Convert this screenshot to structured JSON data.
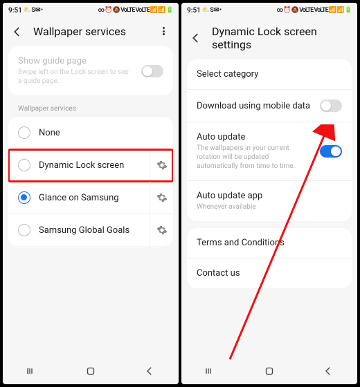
{
  "status": {
    "time": "9:51",
    "left_icons": "⛅ S ✉ •",
    "right_icons": "∞ ⏰ 🔕 VoLTE VoLTE 📶 📶 🔋"
  },
  "left": {
    "title": "Wallpaper services",
    "guide": {
      "title": "Show guide page",
      "sub": "Swipe left on the Lock screen to see a guide page."
    },
    "section_label": "Wallpaper services",
    "items": [
      {
        "label": "None",
        "selected": false,
        "gear": false
      },
      {
        "label": "Dynamic Lock screen",
        "selected": false,
        "gear": true,
        "highlighted": true
      },
      {
        "label": "Glance on Samsung",
        "selected": true,
        "gear": true
      },
      {
        "label": "Samsung Global Goals",
        "selected": false,
        "gear": true
      }
    ]
  },
  "right": {
    "title": "Dynamic Lock screen settings",
    "rows": {
      "select_category": "Select category",
      "download_mobile": "Download using mobile data",
      "auto_update": {
        "title": "Auto update",
        "sub": "The wallpapers in your current rotation will be updated automatically from time to time."
      },
      "auto_update_app": {
        "title": "Auto update app",
        "sub": "Whenever available"
      },
      "terms": "Terms and Conditions",
      "contact": "Contact us"
    }
  }
}
